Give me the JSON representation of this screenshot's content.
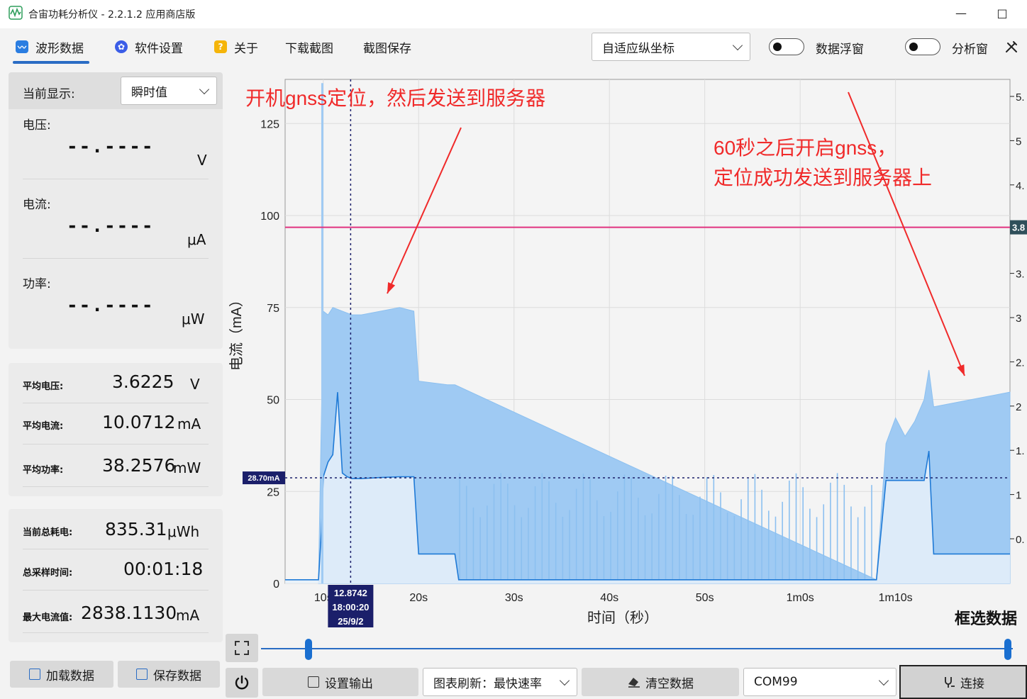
{
  "app": {
    "title": "合宙功耗分析仪 - 2.2.1.2 应用商店版"
  },
  "window": {
    "minimize": "—",
    "maximize": "□"
  },
  "toolbar": {
    "tabs": [
      {
        "label": "波形数据",
        "icon": "wave-icon"
      },
      {
        "label": "软件设置",
        "icon": "gear-icon"
      },
      {
        "label": "关于",
        "icon": "question-icon"
      },
      {
        "label": "下载截图"
      },
      {
        "label": "截图保存"
      }
    ],
    "axis_mode": "自适应纵坐标",
    "data_float_label": "数据浮窗",
    "analysis_label": "分析窗",
    "colors": {
      "accent": "#2a6cc4",
      "question_icon": "#f5b50a"
    }
  },
  "left": {
    "display_label": "当前显示:",
    "display_mode": "瞬时值",
    "voltage": {
      "label": "电压:",
      "value": "--.----",
      "unit": "V"
    },
    "current": {
      "label": "电流:",
      "value": "--.----",
      "unit": "μA"
    },
    "power": {
      "label": "功率:",
      "value": "--.----",
      "unit": "μW"
    },
    "avg_voltage": {
      "label": "平均电压:",
      "value": "3.6225",
      "unit": "V"
    },
    "avg_current": {
      "label": "平均电流:",
      "value": "10.0712",
      "unit": "mA"
    },
    "avg_power": {
      "label": "平均功率:",
      "value": "38.2576",
      "unit": "mW"
    },
    "total_energy": {
      "label": "当前总耗电:",
      "value": "835.31",
      "unit": "μWh"
    },
    "total_time": {
      "label": "总采样时间:",
      "value": "00:01:18"
    },
    "max_current": {
      "label": "最大电流值:",
      "value": "2838.1130",
      "unit": "mA"
    },
    "load_button": "加载数据",
    "save_button": "保存数据"
  },
  "bottom": {
    "output_button": "设置输出",
    "refresh_combo": "图表刷新：最快速率",
    "clear_button": "清空数据",
    "port_combo": "COM99",
    "connect_button": "连接"
  },
  "chart_data": {
    "type": "area",
    "ylabel": "电流（mA）",
    "xlabel": "时间（秒）",
    "ylim": [
      0,
      137
    ],
    "xlim": [
      6,
      82
    ],
    "yticks": [
      "0",
      "25",
      "50",
      "75",
      "100",
      "125"
    ],
    "yticks_values": [
      0,
      25,
      50,
      75,
      100,
      125
    ],
    "xticks": [
      "10s",
      "20s",
      "30s",
      "40s",
      "50s",
      "1m0s",
      "1m10s"
    ],
    "xticks_values": [
      10,
      20,
      30,
      40,
      50,
      60,
      70
    ],
    "right_ticks": [
      "0.",
      "1",
      "1.",
      "2",
      "2.",
      "3",
      "3.",
      "4",
      "4.",
      "5",
      "5."
    ],
    "right_tick_label": "3.8",
    "grid": true,
    "reference_line_value": 96.8,
    "reference_line_color": "#e0337f",
    "cursor": {
      "x": 12.87,
      "y": 28.7,
      "y_label": "28.70mA",
      "x_label_lines": [
        "12.8742",
        "18:00:20",
        "25/9/2"
      ]
    },
    "series": [
      {
        "x": [
          6,
          9.5,
          9.8,
          10,
          10.5,
          11,
          11.5,
          12,
          12.5,
          13,
          14,
          16,
          18,
          19.5,
          20,
          23,
          23.8,
          24.2,
          30,
          40,
          50,
          60,
          68,
          69,
          70,
          72,
          73,
          73.5,
          74,
          82
        ],
        "values": [
          1,
          1,
          14,
          29,
          33,
          35,
          52,
          30,
          29,
          28.5,
          28.5,
          28.8,
          29,
          29,
          8,
          8,
          8,
          1,
          1,
          1,
          1,
          1,
          1,
          28,
          28,
          28,
          28,
          36,
          8,
          8
        ]
      },
      {
        "x": [
          9.5,
          10,
          10.5,
          11,
          12,
          13,
          14,
          16,
          18,
          19.5,
          20,
          23,
          23.8,
          68,
          69,
          70,
          71,
          72,
          73,
          73.5,
          74,
          82
        ],
        "values": [
          1,
          74,
          73,
          75,
          74,
          73,
          73,
          74,
          75,
          74,
          55,
          54,
          54,
          1,
          38,
          45,
          40,
          44,
          50,
          58,
          48,
          52
        ]
      }
    ],
    "annotations": [
      "开机gnss定位，然后发送到服务器",
      "60秒之后开启gnss，",
      "定位成功发送到服务器上"
    ],
    "box_select_label": "框选数据"
  }
}
